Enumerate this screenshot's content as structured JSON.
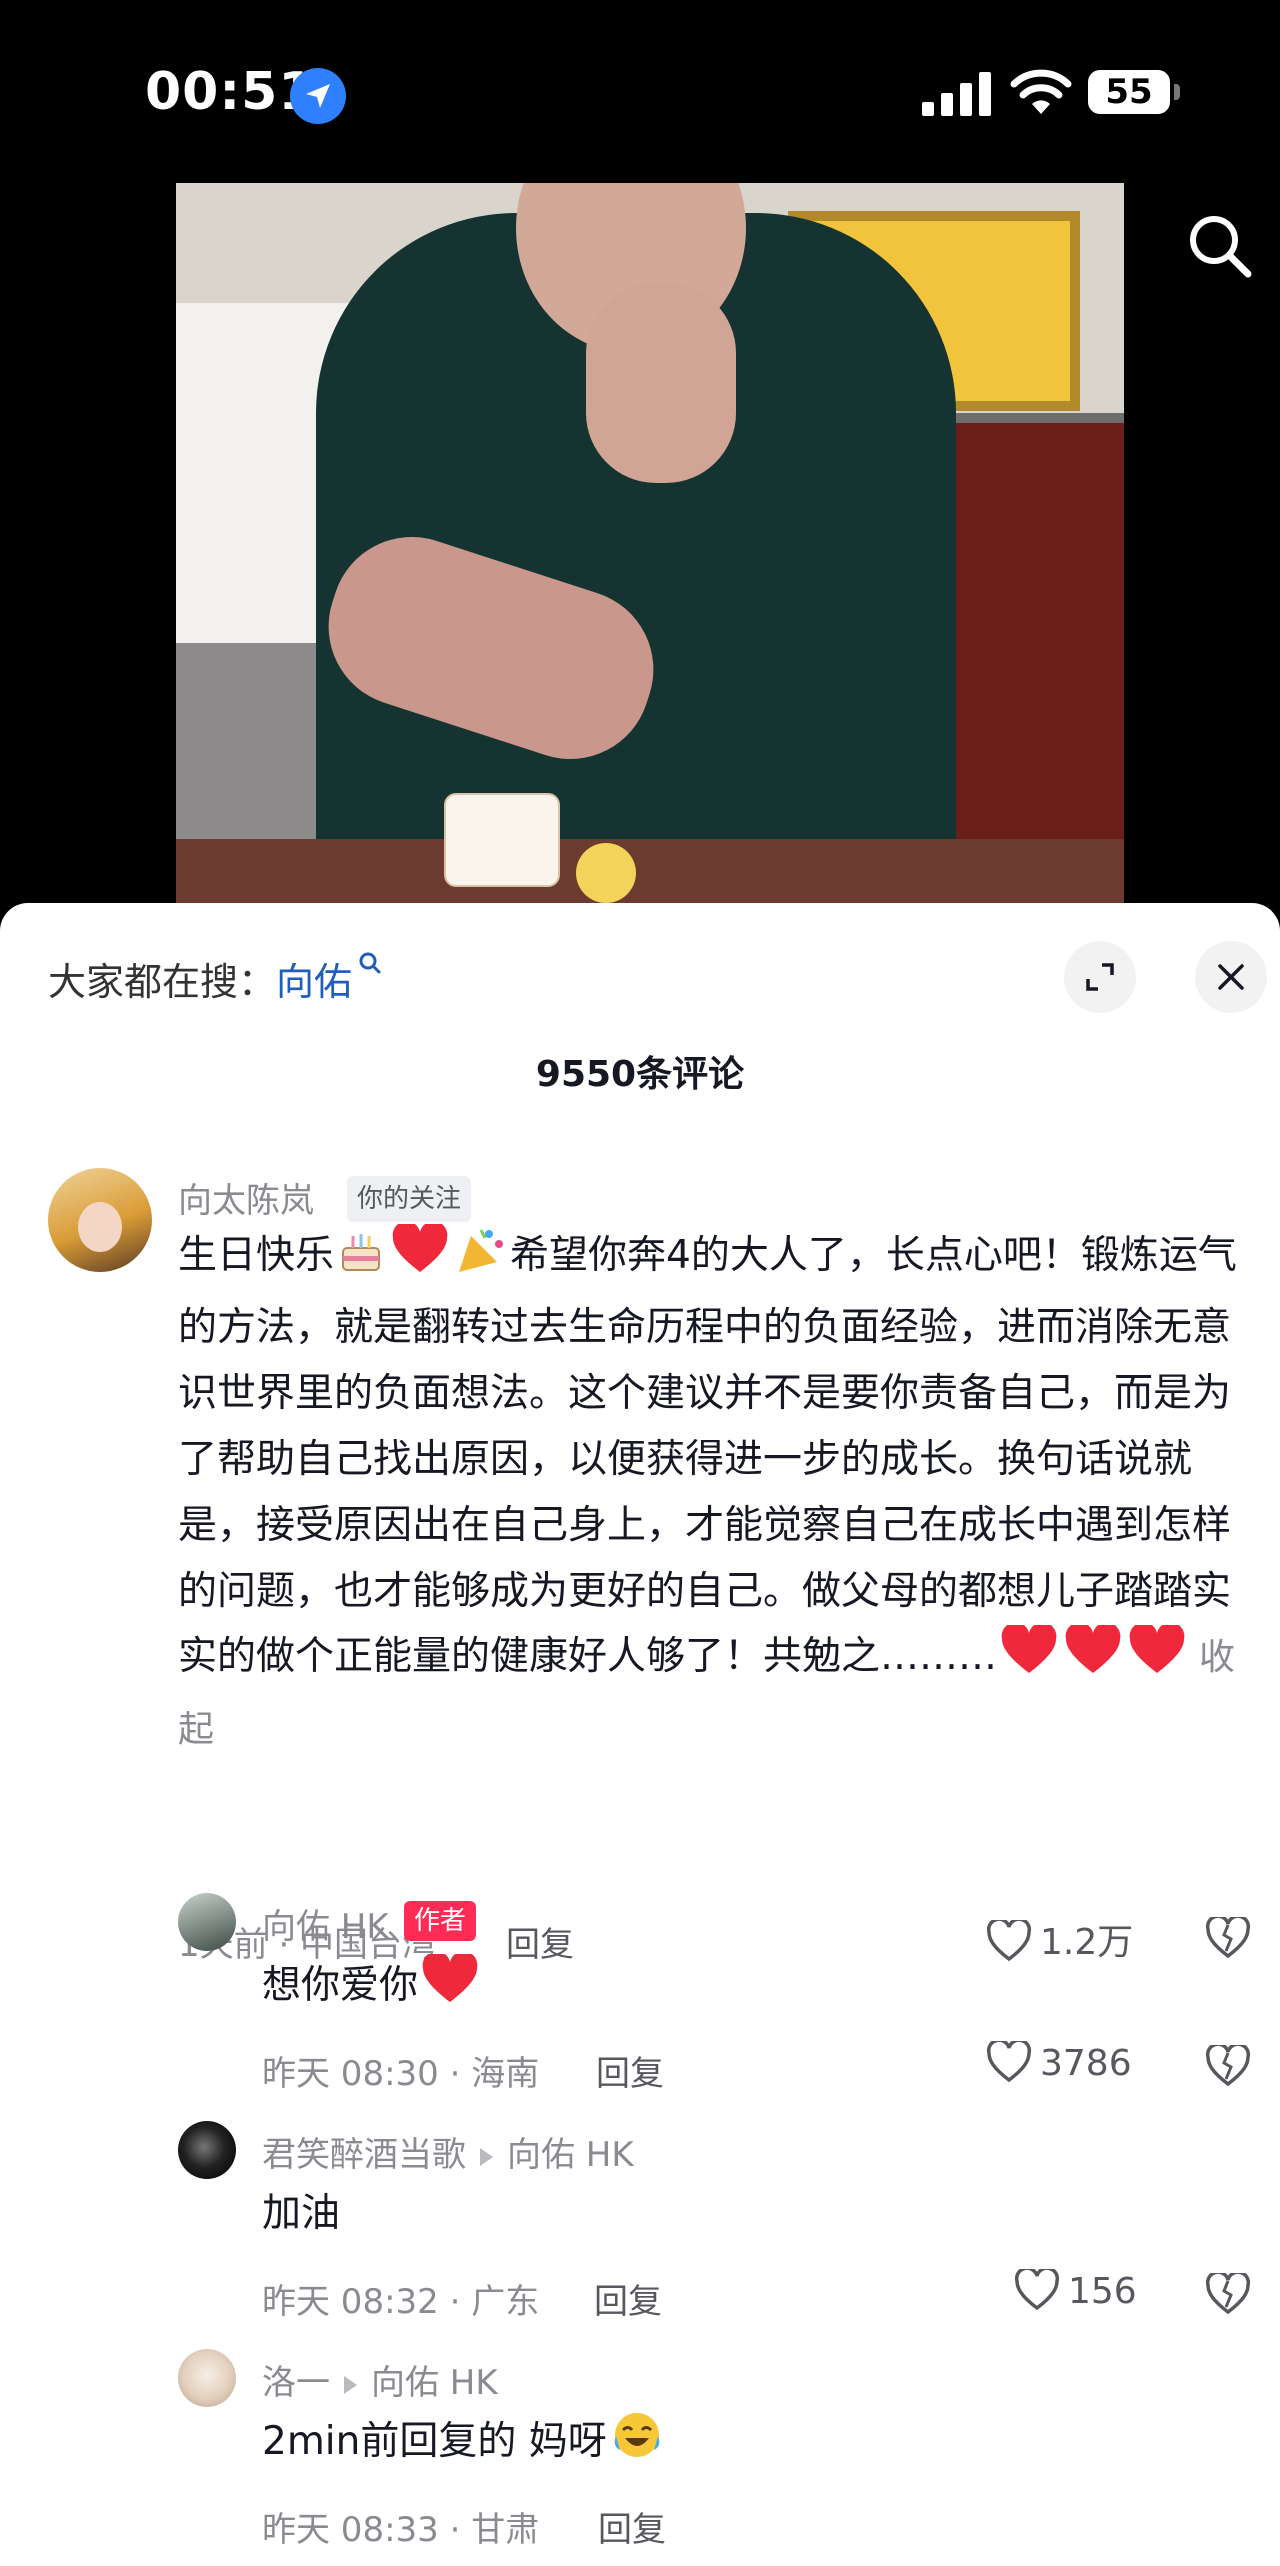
{
  "status_bar": {
    "time": "00:51",
    "battery": "55"
  },
  "panel": {
    "hot_search_prefix": "大家都在搜：",
    "hot_search_keyword": "向佑",
    "comment_count": "9550条评论"
  },
  "main_comment": {
    "username": "向太陈岚",
    "tag": "你的关注",
    "text_part1": "生日快乐",
    "text_part2": "希望你奔4的大人了，长点心吧！锻炼运气的方法，就是翻转过去生命历程中的负面经验，进而消除无意识世界里的负面想法。这个建议并不是要你责备自己，而是为了帮助自己找出原因，以便获得进一步的成长。换句话说就是，接受原因出在自己身上，才能觉察自己在成长中遇到怎样的问题，也才能够成为更好的自己。做父母的都想儿子踏踏实实的做个正能量的健康好人够了！共勉之………",
    "collapse": "收起",
    "meta": "1天前 · 中国台湾",
    "reply": "回复",
    "likes": "1.2万"
  },
  "replies": [
    {
      "username": "向佑 HK",
      "tag": "作者",
      "text": "想你爱你",
      "meta": "昨天 08:30 · 海南",
      "reply": "回复",
      "likes": "3786"
    },
    {
      "username": "君笑醉酒当歌",
      "reply_to": "向佑 HK",
      "text": "加油",
      "meta": "昨天 08:32 · 广东",
      "reply": "回复",
      "likes": "156"
    },
    {
      "username": "洛一",
      "reply_to": "向佑 HK",
      "text": "2min前回复的  妈呀",
      "meta": "昨天 08:33 · 甘肃",
      "reply": "回复"
    }
  ],
  "icons": {
    "status": [
      "location-arrow-icon",
      "signal-icon",
      "wifi-icon",
      "battery-icon"
    ],
    "video": [
      "search-icon"
    ],
    "panel": [
      "search-small-icon",
      "expand-icon",
      "close-icon",
      "heart-icon",
      "dislike-heart-icon",
      "cake-emoji",
      "party-emoji",
      "laughing-crying-emoji"
    ]
  },
  "colors": {
    "accent_red": "#fe2c55",
    "link_blue": "#1f5eba",
    "heart_red": "#f0283c"
  }
}
